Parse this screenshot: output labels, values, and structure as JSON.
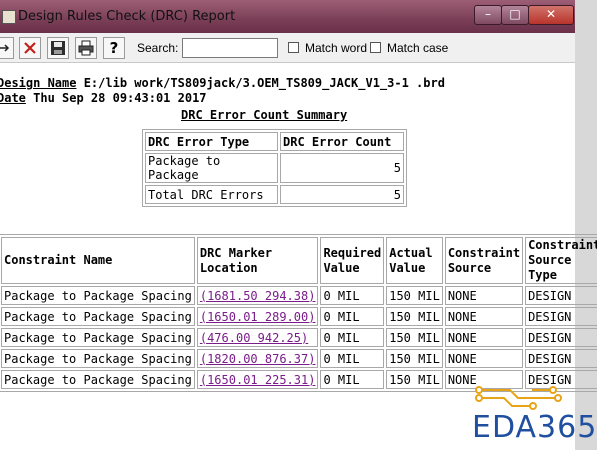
{
  "window": {
    "title": "Design Rules Check (DRC) Report",
    "min_glyph": "–",
    "max_glyph": "□",
    "close_glyph": "✕"
  },
  "toolbar": {
    "search_label": "Search:",
    "search_value": "",
    "match_word_label": "Match word",
    "match_case_label": "Match case",
    "icons": [
      "expand-icon",
      "delete-icon",
      "save-icon",
      "print-icon",
      "help-icon"
    ]
  },
  "report": {
    "design_label": "Design Name",
    "design_value": " E:/lib work/TS809jack/3.OEM_TS809_JACK_V1_3-1 .brd",
    "date_label": "Date",
    "date_value": " Thu Sep 28 09:43:01 2017",
    "summary_title": "DRC Error Count Summary",
    "summary_headers": [
      "DRC Error Type",
      "DRC Error Count"
    ],
    "summary_rows": [
      [
        "Package to Package",
        "5"
      ],
      [
        "Total DRC Errors",
        "5"
      ]
    ],
    "constraint_headers": [
      "Constraint Name",
      "DRC Marker Location",
      "Required Value",
      "Actual Value",
      "Constraint Source",
      "Constraint Source Type"
    ],
    "constraint_rows": [
      [
        "Package to Package Spacing",
        "(1681.50 294.38)",
        "0 MIL",
        "150 MIL",
        "NONE",
        "DESIGN"
      ],
      [
        "Package to Package Spacing",
        "(1650.01 289.00)",
        "0 MIL",
        "150 MIL",
        "NONE",
        "DESIGN"
      ],
      [
        "Package to Package Spacing",
        "(476.00 942.25)",
        "0 MIL",
        "150 MIL",
        "NONE",
        "DESIGN"
      ],
      [
        "Package to Package Spacing",
        "(1820.00 876.37)",
        "0 MIL",
        "150 MIL",
        "NONE",
        "DESIGN"
      ],
      [
        "Package to Package Spacing",
        "(1650.01 225.31)",
        "0 MIL",
        "150 MIL",
        "NONE",
        "DESIGN"
      ]
    ]
  },
  "watermark": {
    "text": "EDA365",
    "color": "#1f4f9e",
    "accent": "#e8a317"
  }
}
